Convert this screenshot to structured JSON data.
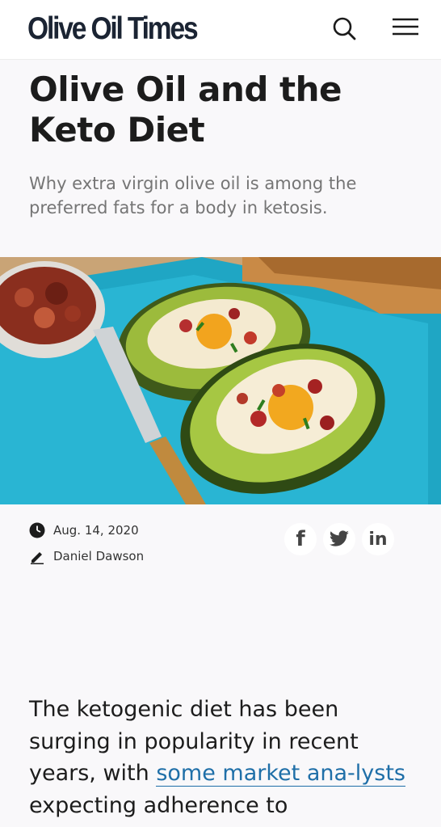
{
  "header": {
    "logo_text": "Olive Oil Times",
    "search_icon": "search-icon",
    "menu_icon": "hamburger-menu-icon"
  },
  "article": {
    "title": "Olive Oil and the Keto Diet",
    "subtitle": "Why extra virgin olive oil is among the preferred fats for a body in ketosis.",
    "date": "Aug. 14, 2020",
    "author": "Daniel Dawson",
    "body_before_link": "The ketogenic diet has been surging in popularity in recent years, with ",
    "body_link": "some market ana-lysts",
    "body_after_link": " expecting adherence to"
  },
  "share": {
    "facebook": "f",
    "twitter": "twitter-icon",
    "linkedin": "in"
  },
  "colors": {
    "logo": "#1b2433",
    "link": "#1f6fa8",
    "subtitle": "#757575"
  }
}
